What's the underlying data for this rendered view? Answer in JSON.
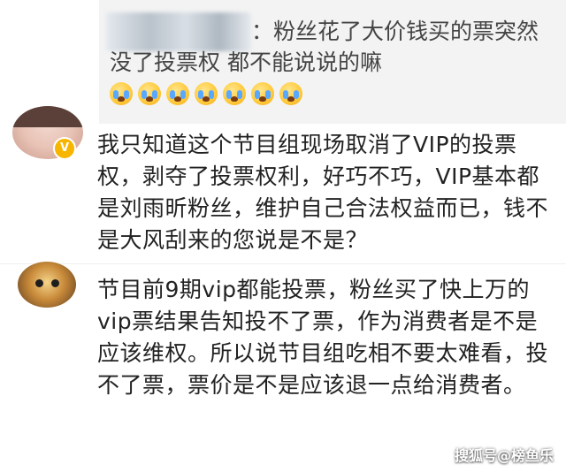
{
  "quoted_comment": {
    "text": "：粉丝花了大价钱买的票突然没了投票权 都不能说说的嘛",
    "emoji_icon": "crying-face-emoji",
    "emoji_count": 7
  },
  "comments": [
    {
      "avatar_icon": "user-avatar",
      "verified_badge": "V",
      "text": "我只知道这个节目组现场取消了VIP的投票权，剥夺了投票权利，好巧不巧，VIP基本都是刘雨昕粉丝，维护自己合法权益而已，钱不是大风刮来的您说是不是？"
    },
    {
      "avatar_icon": "cartoon-avatar",
      "text": "节目前9期vip都能投票，粉丝买了快上万的vip票结果告知投不了票，作为消费者是不是应该维权。所以说节目组吃相不要太难看，投不了票，票价是不是应该退一点给消费者。"
    }
  ],
  "watermark": "搜狐号@榜鱼乐"
}
